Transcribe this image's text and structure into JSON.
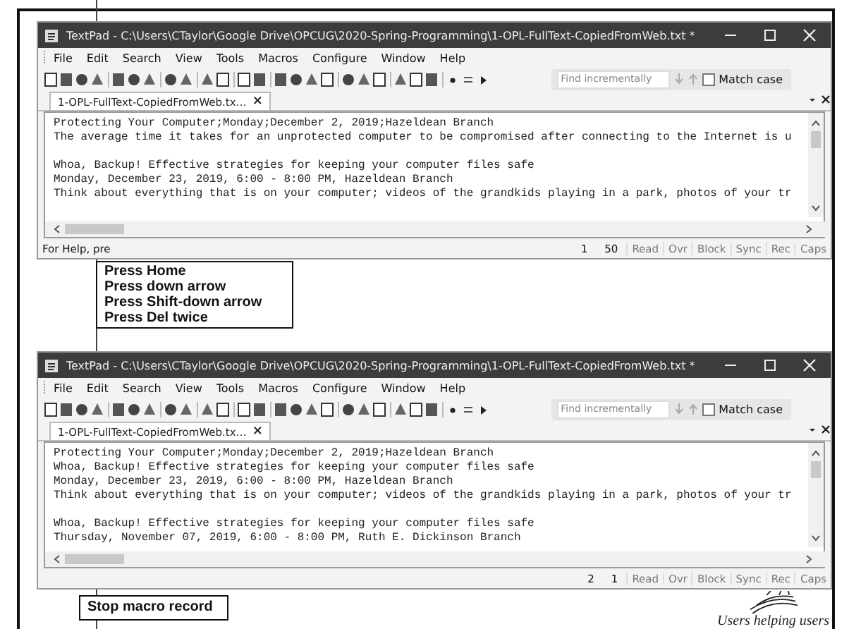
{
  "panels": [
    {
      "kind": "window",
      "title": "TextPad - C:\\Users\\CTaylor\\Google Drive\\OPCUG\\2020-Spring-Programming\\1-OPL-FullText-CopiedFromWeb.txt *",
      "menu": [
        "File",
        "Edit",
        "Search",
        "View",
        "Tools",
        "Macros",
        "Configure",
        "Window",
        "Help"
      ],
      "search": {
        "placeholder": "Find incrementally"
      },
      "match_case": {
        "label": "Match case",
        "checked": false
      },
      "tab": {
        "label": "1-OPL-FullText-CopiedFromWeb.tx…",
        "close": "×"
      },
      "paragraphs": [
        [
          "Protecting Your Computer;Monday;December 2, 2019;Hazeldean Branch",
          "The average time it takes for an unprotected computer to be compromised after connecting to the Internet is u"
        ],
        [
          "Whoa, Backup! Effective strategies for keeping your computer files safe",
          "Monday, December 23, 2019, 6:00 - 8:00 PM, Hazeldean Branch",
          "Think about everything that is on your computer; videos of the grandkids playing in a park, photos of your tr"
        ]
      ],
      "status_text": "For Help, pre",
      "status_cells": [
        "1",
        "50",
        "Read",
        "Ovr",
        "Block",
        "Sync",
        "Rec",
        "Caps"
      ]
    },
    {
      "kind": "callout",
      "lines": [
        "Press Home",
        "Press down arrow",
        "Press Shift-down arrow",
        "Press Del twice"
      ]
    },
    {
      "kind": "window",
      "title": "TextPad - C:\\Users\\CTaylor\\Google Drive\\OPCUG\\2020-Spring-Programming\\1-OPL-FullText-CopiedFromWeb.txt *",
      "menu": [
        "File",
        "Edit",
        "Search",
        "View",
        "Tools",
        "Macros",
        "Configure",
        "Window",
        "Help"
      ],
      "search": {
        "placeholder": "Find incrementally"
      },
      "match_case": {
        "label": "Match case",
        "checked": false
      },
      "tab": {
        "label": "1-OPL-FullText-CopiedFromWeb.tx…",
        "close": "×"
      },
      "paragraphs": [
        [
          "Protecting Your Computer;Monday;December 2, 2019;Hazeldean Branch",
          "Whoa, Backup! Effective strategies for keeping your computer files safe",
          "Monday, December 23, 2019, 6:00 - 8:00 PM, Hazeldean Branch",
          "Think about everything that is on your computer; videos of the grandkids playing in a park, photos of your tr"
        ],
        [
          "Whoa, Backup! Effective strategies for keeping your computer files safe",
          "Thursday, November 07, 2019, 6:00 - 8:00 PM, Ruth E. Dickinson Branch"
        ]
      ],
      "status_cells": [
        "2",
        "1",
        "Read",
        "Ovr",
        "Block",
        "Sync",
        "Rec",
        "Caps"
      ]
    },
    {
      "kind": "callout",
      "lines": [
        "Stop macro record"
      ]
    }
  ],
  "logo": {
    "tagline": "Users helping users"
  }
}
